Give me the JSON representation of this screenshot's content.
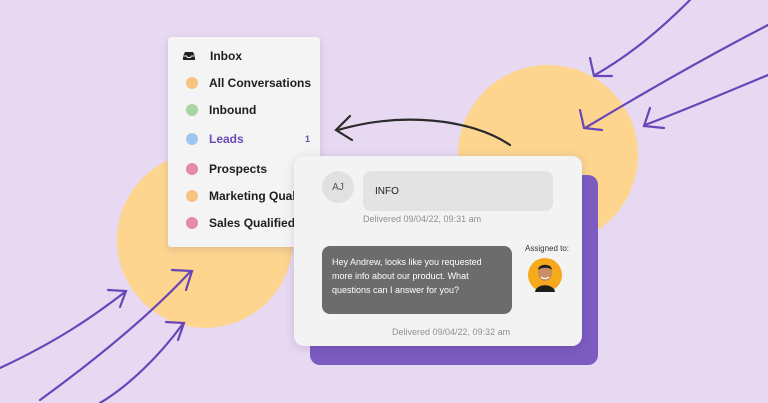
{
  "menu": {
    "header": {
      "icon": "inbox-tray-icon",
      "title": "Inbox"
    },
    "items": [
      {
        "label": "All Conversations",
        "color": "#f6c47f"
      },
      {
        "label": "Inbound",
        "color": "#a5d6a3"
      },
      {
        "label": "Leads",
        "color": "#9fc6ef",
        "active": true,
        "count": "1"
      },
      {
        "label": "Prospects",
        "color": "#e68aa6"
      },
      {
        "label": "Marketing Qualified",
        "color": "#f6c47f"
      },
      {
        "label": "Sales Qualified",
        "color": "#e68aa6"
      }
    ]
  },
  "chat": {
    "incoming": {
      "initials": "AJ",
      "text": "INFO",
      "meta": "Delivered 09/04/22, 09:31 am"
    },
    "outgoing": {
      "text": "Hey Andrew, looks like you requested more info about our product. What questions can I answer for you?",
      "meta": "Delivered 09/04/22, 09:32 am",
      "assigned_label": "Assigned to:"
    }
  },
  "colors": {
    "background": "#e8d9f3",
    "accent_purple": "#7c5cc0",
    "blob_yellow": "#fdd58f",
    "arrow_purple": "#6a45b8"
  }
}
